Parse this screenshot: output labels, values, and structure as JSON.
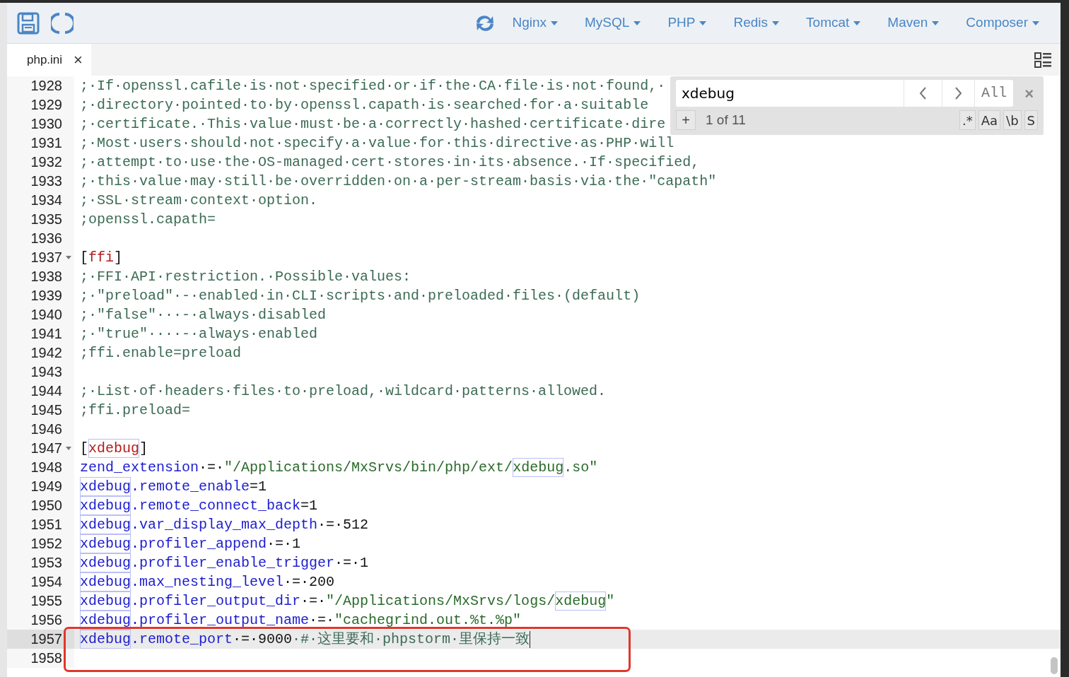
{
  "toolbar": {
    "menus": [
      {
        "label": "Nginx"
      },
      {
        "label": "MySQL"
      },
      {
        "label": "PHP"
      },
      {
        "label": "Redis"
      },
      {
        "label": "Tomcat"
      },
      {
        "label": "Maven"
      },
      {
        "label": "Composer"
      }
    ]
  },
  "tabs": [
    {
      "label": "php.ini",
      "close": "×",
      "selected": true
    }
  ],
  "search": {
    "value": "xdebug",
    "all": "All",
    "close": "×",
    "add": "+",
    "count": "1 of 11",
    "options": [
      ".*",
      "Aa",
      "\\b",
      "S"
    ]
  },
  "lines": [
    {
      "number": "1928",
      "tokens": [
        {
          "kind": "comment",
          "text": ";·If·openssl.cafile·is·not·specified·or·if·the·CA·file·is·not·found,·"
        }
      ]
    },
    {
      "number": "1929",
      "tokens": [
        {
          "kind": "comment",
          "text": ";·directory·pointed·to·by·openssl.capath·is·searched·for·a·suitable"
        }
      ]
    },
    {
      "number": "1930",
      "tokens": [
        {
          "kind": "comment",
          "text": ";·certificate.·This·value·must·be·a·correctly·hashed·certificate·dire"
        }
      ]
    },
    {
      "number": "1931",
      "tokens": [
        {
          "kind": "comment",
          "text": ";·Most·users·should·not·specify·a·value·for·this·directive·as·PHP·will"
        }
      ]
    },
    {
      "number": "1932",
      "tokens": [
        {
          "kind": "comment",
          "text": ";·attempt·to·use·the·OS-managed·cert·stores·in·its·absence.·If·specified,"
        }
      ]
    },
    {
      "number": "1933",
      "tokens": [
        {
          "kind": "comment",
          "text": ";·this·value·may·still·be·overridden·on·a·per-stream·basis·via·the·\"capath\""
        }
      ]
    },
    {
      "number": "1934",
      "tokens": [
        {
          "kind": "comment",
          "text": ";·SSL·stream·context·option."
        }
      ]
    },
    {
      "number": "1935",
      "tokens": [
        {
          "kind": "comment",
          "text": ";openssl.capath="
        }
      ]
    },
    {
      "number": "1936"
    },
    {
      "number": "1937",
      "foldable": true,
      "tokens": [
        {
          "kind": "plain",
          "text": "["
        },
        {
          "kind": "section",
          "text": "ffi"
        },
        {
          "kind": "plain",
          "text": "]"
        }
      ]
    },
    {
      "number": "1938",
      "tokens": [
        {
          "kind": "comment",
          "text": ";·FFI·API·restriction.·Possible·values:"
        }
      ]
    },
    {
      "number": "1939",
      "tokens": [
        {
          "kind": "comment",
          "text": ";·\"preload\"·-·enabled·in·CLI·scripts·and·preloaded·files·(default)"
        }
      ]
    },
    {
      "number": "1940",
      "tokens": [
        {
          "kind": "comment",
          "text": ";·\"false\"···-·always·disabled"
        }
      ]
    },
    {
      "number": "1941",
      "tokens": [
        {
          "kind": "comment",
          "text": ";·\"true\"····-·always·enabled"
        }
      ]
    },
    {
      "number": "1942",
      "tokens": [
        {
          "kind": "comment",
          "text": ";ffi.enable=preload"
        }
      ]
    },
    {
      "number": "1943"
    },
    {
      "number": "1944",
      "tokens": [
        {
          "kind": "comment",
          "text": ";·List·of·headers·files·to·preload,·wildcard·patterns·allowed."
        }
      ]
    },
    {
      "number": "1945",
      "tokens": [
        {
          "kind": "comment",
          "text": ";ffi.preload="
        }
      ]
    },
    {
      "number": "1946"
    },
    {
      "number": "1947",
      "foldable": true,
      "tokens": [
        {
          "kind": "plain",
          "text": "["
        },
        {
          "kind": "section",
          "text": "xdebug",
          "match": true
        },
        {
          "kind": "plain",
          "text": "]"
        }
      ]
    },
    {
      "number": "1948",
      "tokens": [
        {
          "kind": "key",
          "text": "zend_extension"
        },
        {
          "kind": "plain",
          "text": "·=·"
        },
        {
          "kind": "string",
          "text": "\"/Applications/MxSrvs/bin/php/ext/"
        },
        {
          "kind": "string",
          "text": "xdebug",
          "match": true
        },
        {
          "kind": "string",
          "text": ".so\""
        }
      ]
    },
    {
      "number": "1949",
      "tokens": [
        {
          "kind": "key",
          "text": "xdebug",
          "match": true
        },
        {
          "kind": "key",
          "text": ".remote_enable"
        },
        {
          "kind": "plain",
          "text": "=1"
        }
      ]
    },
    {
      "number": "1950",
      "tokens": [
        {
          "kind": "key",
          "text": "xdebug",
          "match": true
        },
        {
          "kind": "key",
          "text": ".remote_connect_back"
        },
        {
          "kind": "plain",
          "text": "=1"
        }
      ]
    },
    {
      "number": "1951",
      "tokens": [
        {
          "kind": "key",
          "text": "xdebug",
          "match": true
        },
        {
          "kind": "key",
          "text": ".var_display_max_depth"
        },
        {
          "kind": "plain",
          "text": "·=·512"
        }
      ]
    },
    {
      "number": "1952",
      "tokens": [
        {
          "kind": "key",
          "text": "xdebug",
          "match": true
        },
        {
          "kind": "key",
          "text": ".profiler_append"
        },
        {
          "kind": "plain",
          "text": "·=·1"
        }
      ]
    },
    {
      "number": "1953",
      "tokens": [
        {
          "kind": "key",
          "text": "xdebug",
          "match": true
        },
        {
          "kind": "key",
          "text": ".profiler_enable_trigger"
        },
        {
          "kind": "plain",
          "text": "·=·1"
        }
      ]
    },
    {
      "number": "1954",
      "tokens": [
        {
          "kind": "key",
          "text": "xdebug",
          "match": true
        },
        {
          "kind": "key",
          "text": ".max_nesting_level"
        },
        {
          "kind": "plain",
          "text": "·=·200"
        }
      ]
    },
    {
      "number": "1955",
      "tokens": [
        {
          "kind": "key",
          "text": "xdebug",
          "match": true
        },
        {
          "kind": "key",
          "text": ".profiler_output_dir"
        },
        {
          "kind": "plain",
          "text": "·=·"
        },
        {
          "kind": "string",
          "text": "\"/Applications/MxSrvs/logs/"
        },
        {
          "kind": "string",
          "text": "xdebug",
          "match": true
        },
        {
          "kind": "string",
          "text": "\""
        }
      ]
    },
    {
      "number": "1956",
      "tokens": [
        {
          "kind": "key",
          "text": "xdebug",
          "match": true
        },
        {
          "kind": "key",
          "text": ".profiler_output_name"
        },
        {
          "kind": "plain",
          "text": "·=·"
        },
        {
          "kind": "string",
          "text": "\"cachegrind.out.%t.%p\""
        }
      ]
    },
    {
      "number": "1957",
      "active": true,
      "boxed": true,
      "tokens": [
        {
          "kind": "key",
          "text": "xdebug",
          "match": true
        },
        {
          "kind": "key",
          "text": ".remote_port"
        },
        {
          "kind": "plain",
          "text": "·=·9000"
        },
        {
          "kind": "comment",
          "text": "·#·这里要和·phpstorm·里保持一致"
        }
      ]
    },
    {
      "number": "1958",
      "boxed": true
    }
  ]
}
